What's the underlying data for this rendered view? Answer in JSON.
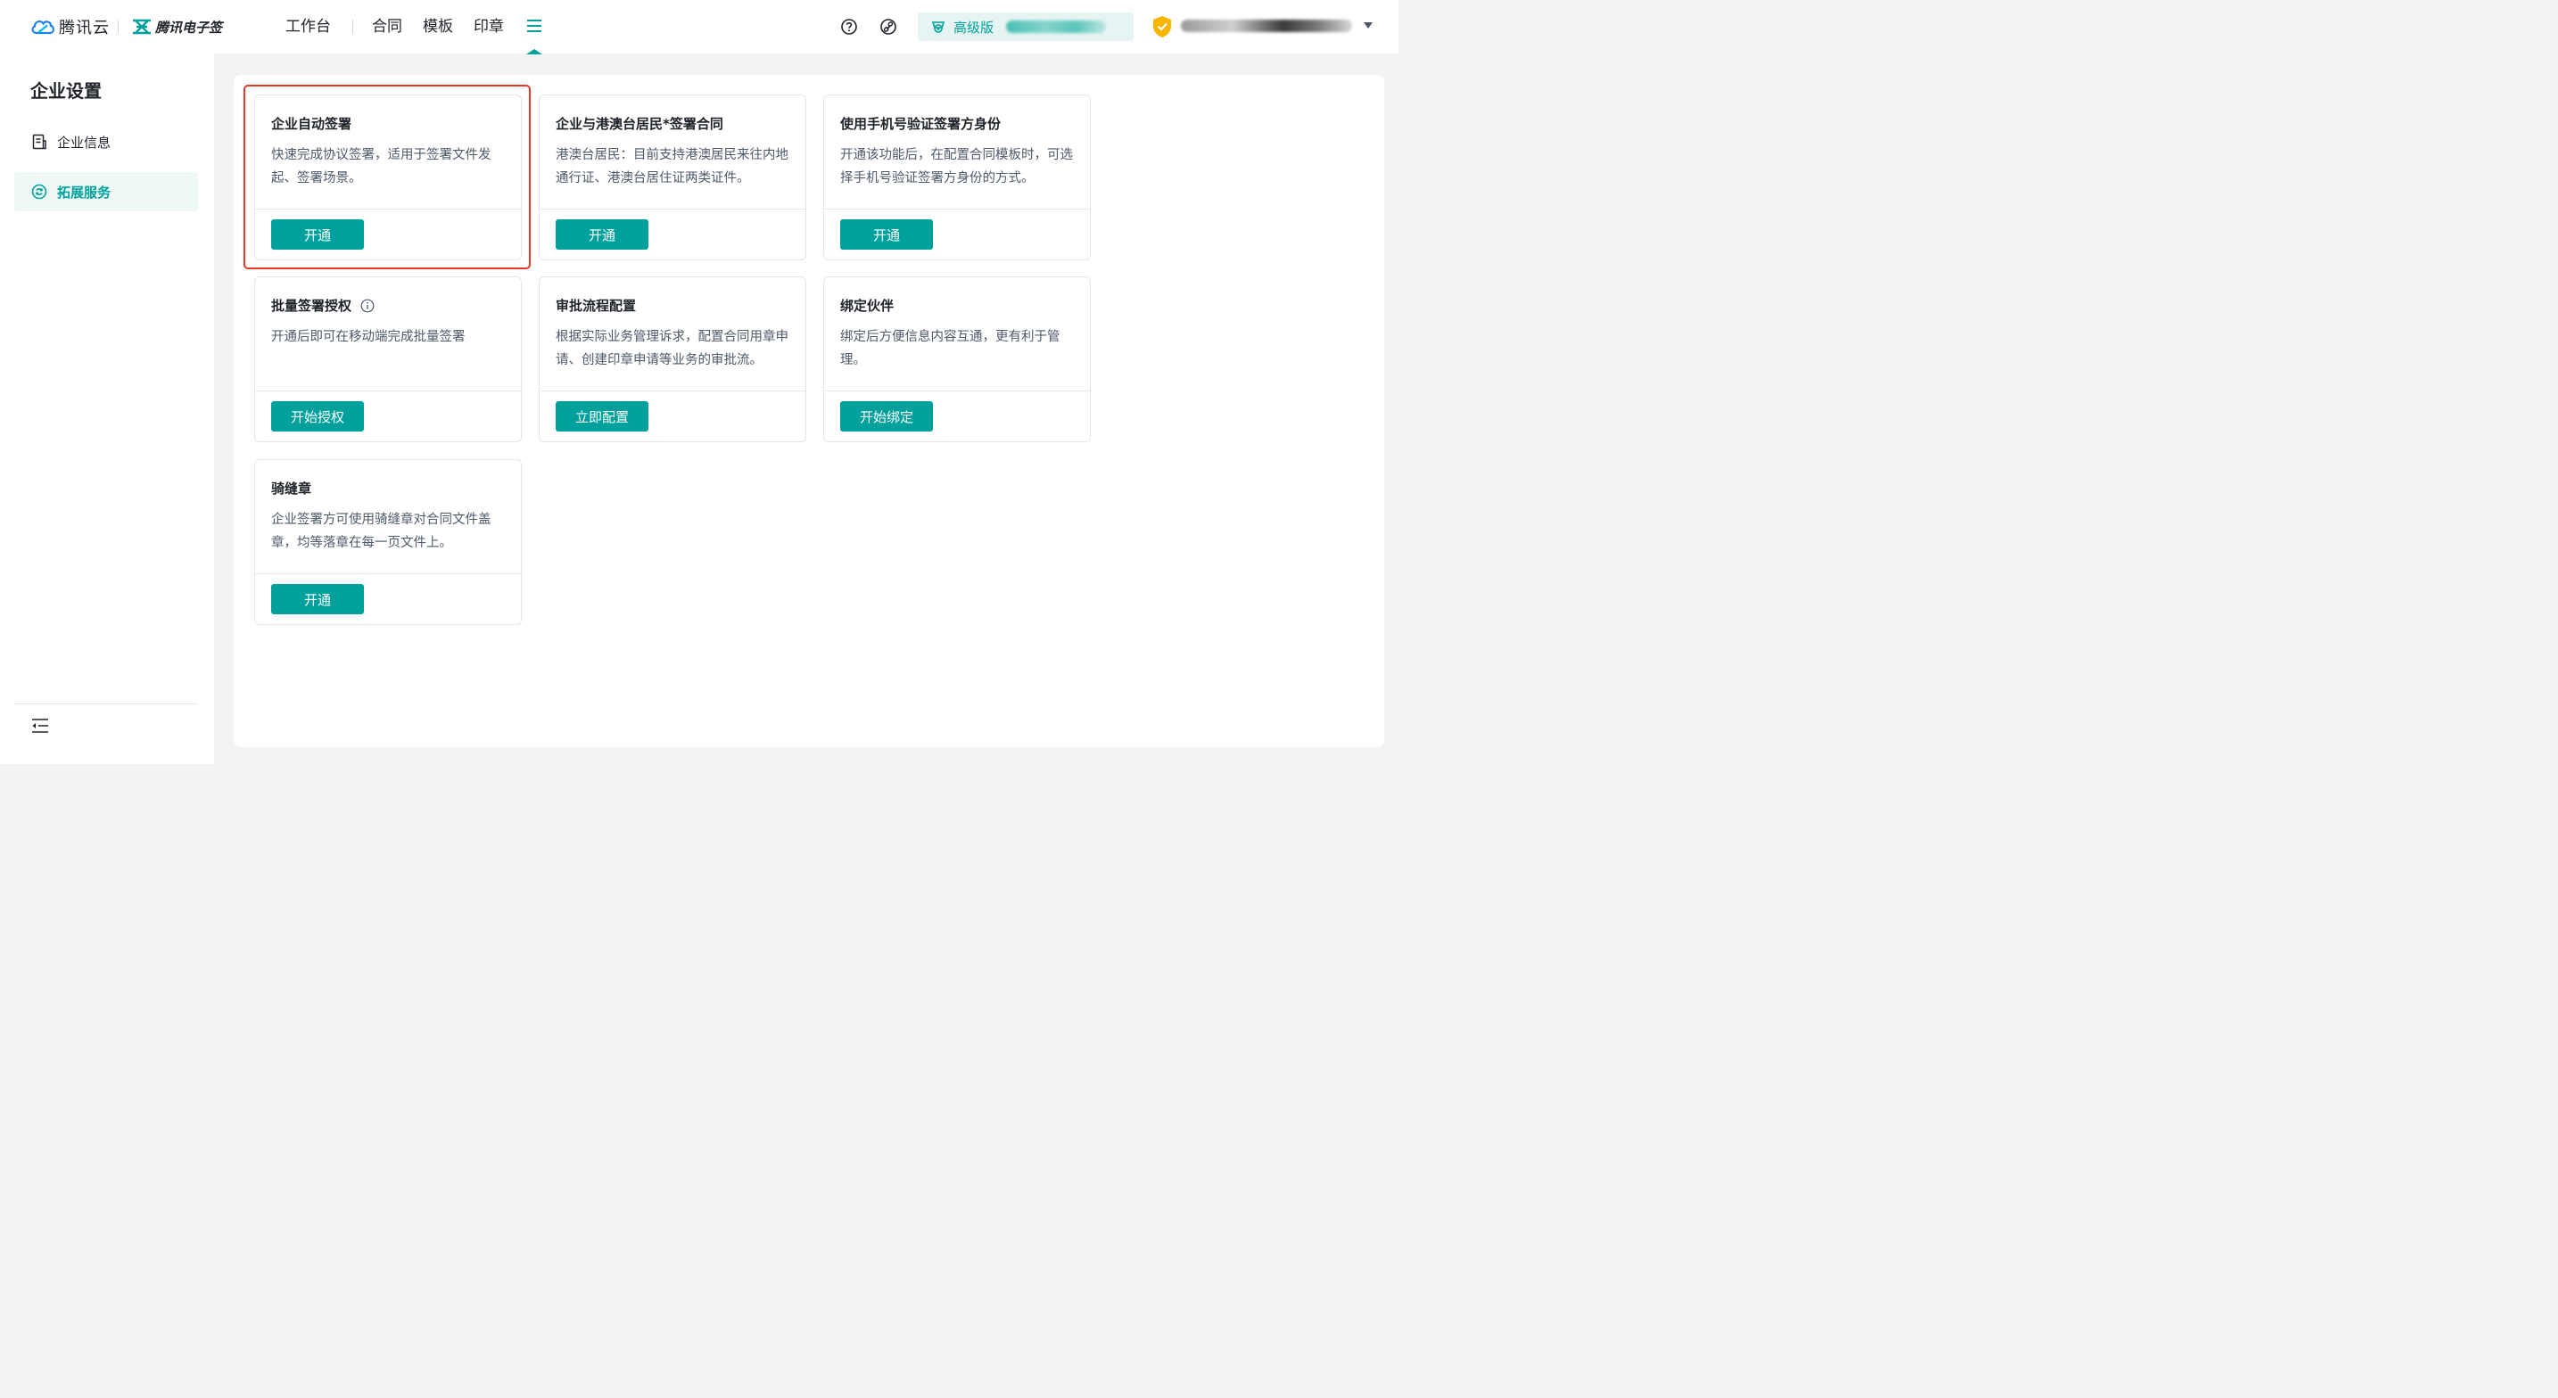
{
  "header": {
    "brand_tencent": "腾讯云",
    "brand_esign": "腾讯电子签",
    "nav": [
      "工作台",
      "合同",
      "模板",
      "印章"
    ],
    "plan_label": "高级版"
  },
  "sidebar": {
    "title": "企业设置",
    "items": [
      {
        "label": "企业信息",
        "icon": "document-icon",
        "active": false
      },
      {
        "label": "拓展服务",
        "icon": "extension-icon",
        "active": true
      }
    ]
  },
  "cards": [
    {
      "title": "企业自动签署",
      "desc": "快速完成协议签署，适用于签署文件发起、签署场景。",
      "button": "开通",
      "highlighted": true
    },
    {
      "title": "企业与港澳台居民*签署合同",
      "desc": "港澳台居民：目前支持港澳居民来往内地通行证、港澳台居住证两类证件。",
      "button": "开通"
    },
    {
      "title": "使用手机号验证签署方身份",
      "desc": "开通该功能后，在配置合同模板时，可选择手机号验证签署方身份的方式。",
      "button": "开通"
    },
    {
      "title": "批量签署授权",
      "desc": "开通后即可在移动端完成批量签署",
      "button": "开始授权",
      "info_icon": true
    },
    {
      "title": "审批流程配置",
      "desc": "根据实际业务管理诉求，配置合同用章申请、创建印章申请等业务的审批流。",
      "button": "立即配置"
    },
    {
      "title": "绑定伙伴",
      "desc": "绑定后方便信息内容互通，更有利于管理。",
      "button": "开始绑定"
    },
    {
      "title": "骑缝章",
      "desc": "企业签署方可使用骑缝章对合同文件盖章，均等落章在每一页文件上。",
      "button": "开通"
    }
  ],
  "colors": {
    "accent": "#00a19c",
    "highlight": "#e5392c"
  }
}
